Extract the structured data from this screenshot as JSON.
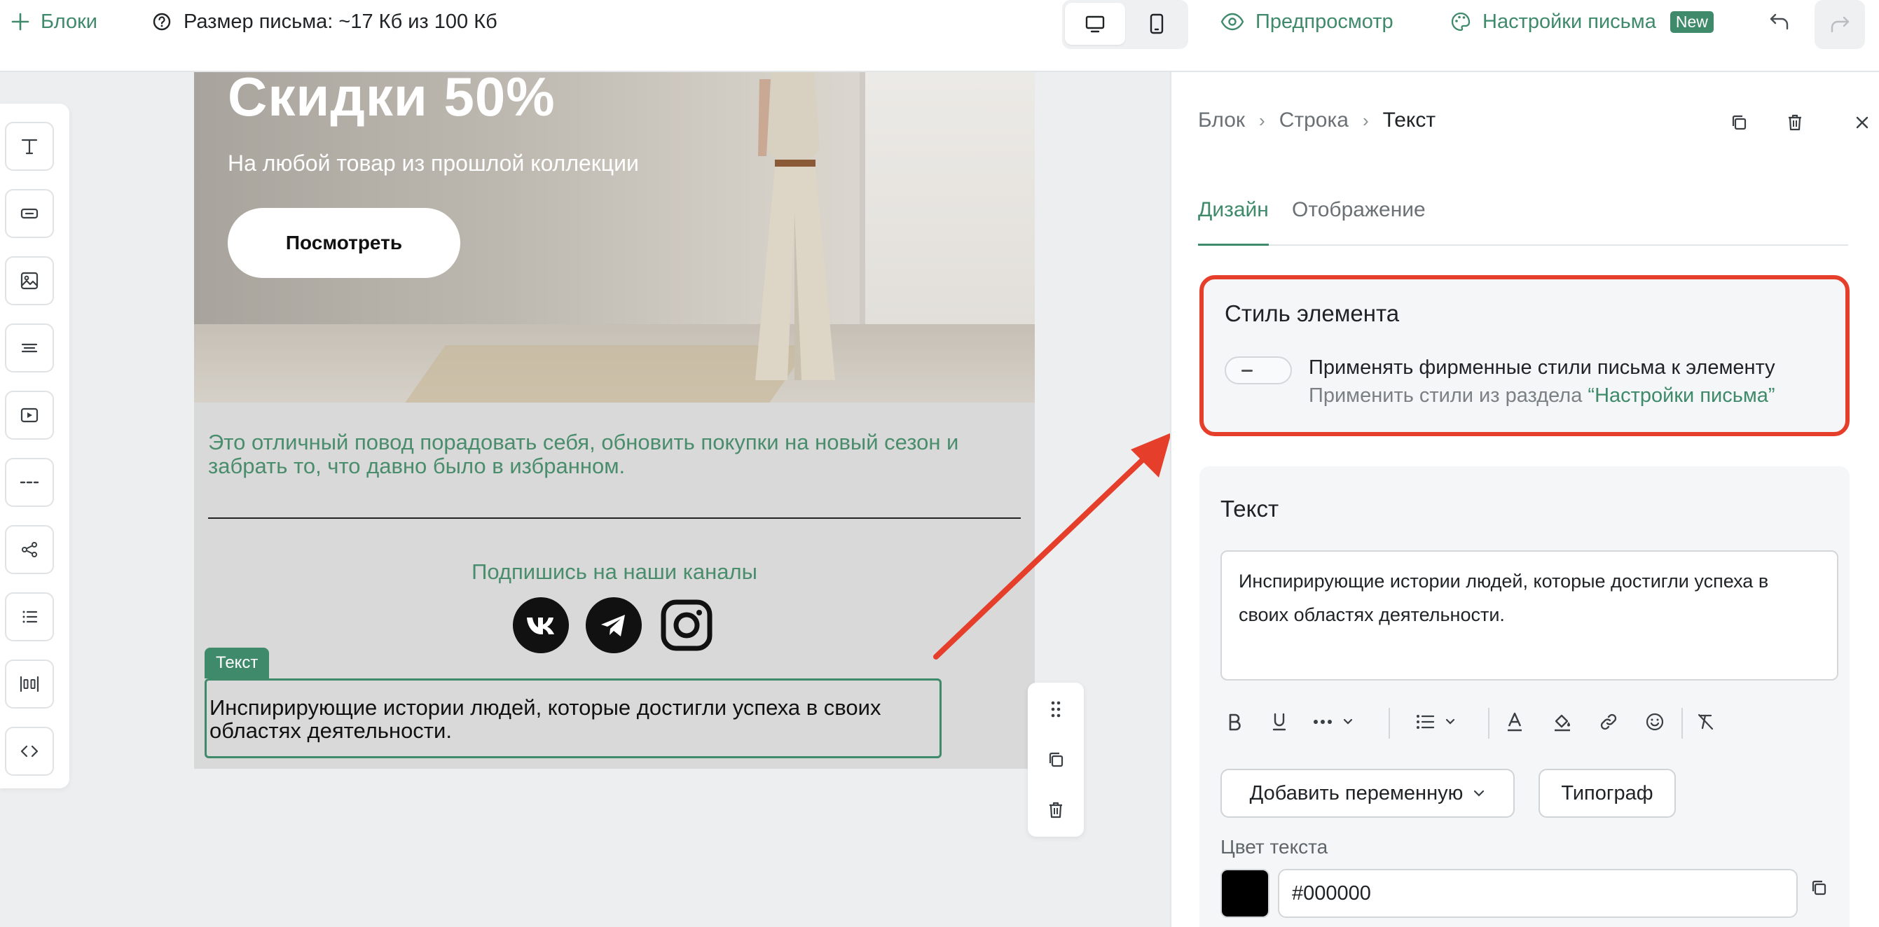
{
  "topbar": {
    "blocks_label": "Блоки",
    "size_label": "Размер письма: ~17 Кб из 100 Кб",
    "preview_label": "Предпросмотр",
    "settings_label": "Настройки письма",
    "settings_badge": "New"
  },
  "email": {
    "hero_title": "Скидки 50%",
    "hero_subtitle": "На любой товар из прошлой коллекции",
    "hero_button": "Посмотреть",
    "paragraph": "Это отличный повод порадовать себя, обновить покупки на новый сезон и забрать то, что давно было в избранном.",
    "subscribe_text": "Подпишись на наши каналы",
    "selected_label": "Текст",
    "selected_text": "Инспирирующие истории людей, которые достигли успеха в своих областях деятельности."
  },
  "panel": {
    "breadcrumb": [
      "Блок",
      "Строка",
      "Текст"
    ],
    "tabs": [
      "Дизайн",
      "Отображение"
    ],
    "style_card": {
      "title": "Стиль элемента",
      "toggle_label": "Применять фирменные стили письма к элементу",
      "toggle_desc_prefix": "Применить стили из раздела ",
      "toggle_desc_link": "“Настройки письма”",
      "toggle_on": false
    },
    "text_card": {
      "title": "Текст",
      "editor_text": "Инспирирующие истории людей, которые достигли успеха в своих областях деятельности.",
      "add_variable": "Добавить переменную",
      "typograf": "Типограф",
      "color_label": "Цвет текста",
      "color_value": "#000000"
    }
  },
  "colors": {
    "accent": "#3f8a6a",
    "highlight": "#e53e2b",
    "text_color": "#000000"
  },
  "icons": [
    "plus-icon",
    "help-circle-icon",
    "desktop-icon",
    "mobile-icon",
    "eye-icon",
    "palette-icon",
    "undo-icon",
    "redo-icon",
    "text-block-icon",
    "button-block-icon",
    "image-block-icon",
    "menu-block-icon",
    "video-block-icon",
    "divider-block-icon",
    "share-block-icon",
    "list-block-icon",
    "columns-block-icon",
    "code-block-icon",
    "drag-icon",
    "duplicate-icon",
    "trash-icon",
    "close-icon",
    "bold-icon",
    "underline-icon",
    "more-icon",
    "chevron-down-icon",
    "bullet-list-icon",
    "text-color-icon",
    "fill-color-icon",
    "link-icon",
    "emoji-icon",
    "clear-format-icon",
    "vk-icon",
    "telegram-icon",
    "instagram-icon"
  ]
}
